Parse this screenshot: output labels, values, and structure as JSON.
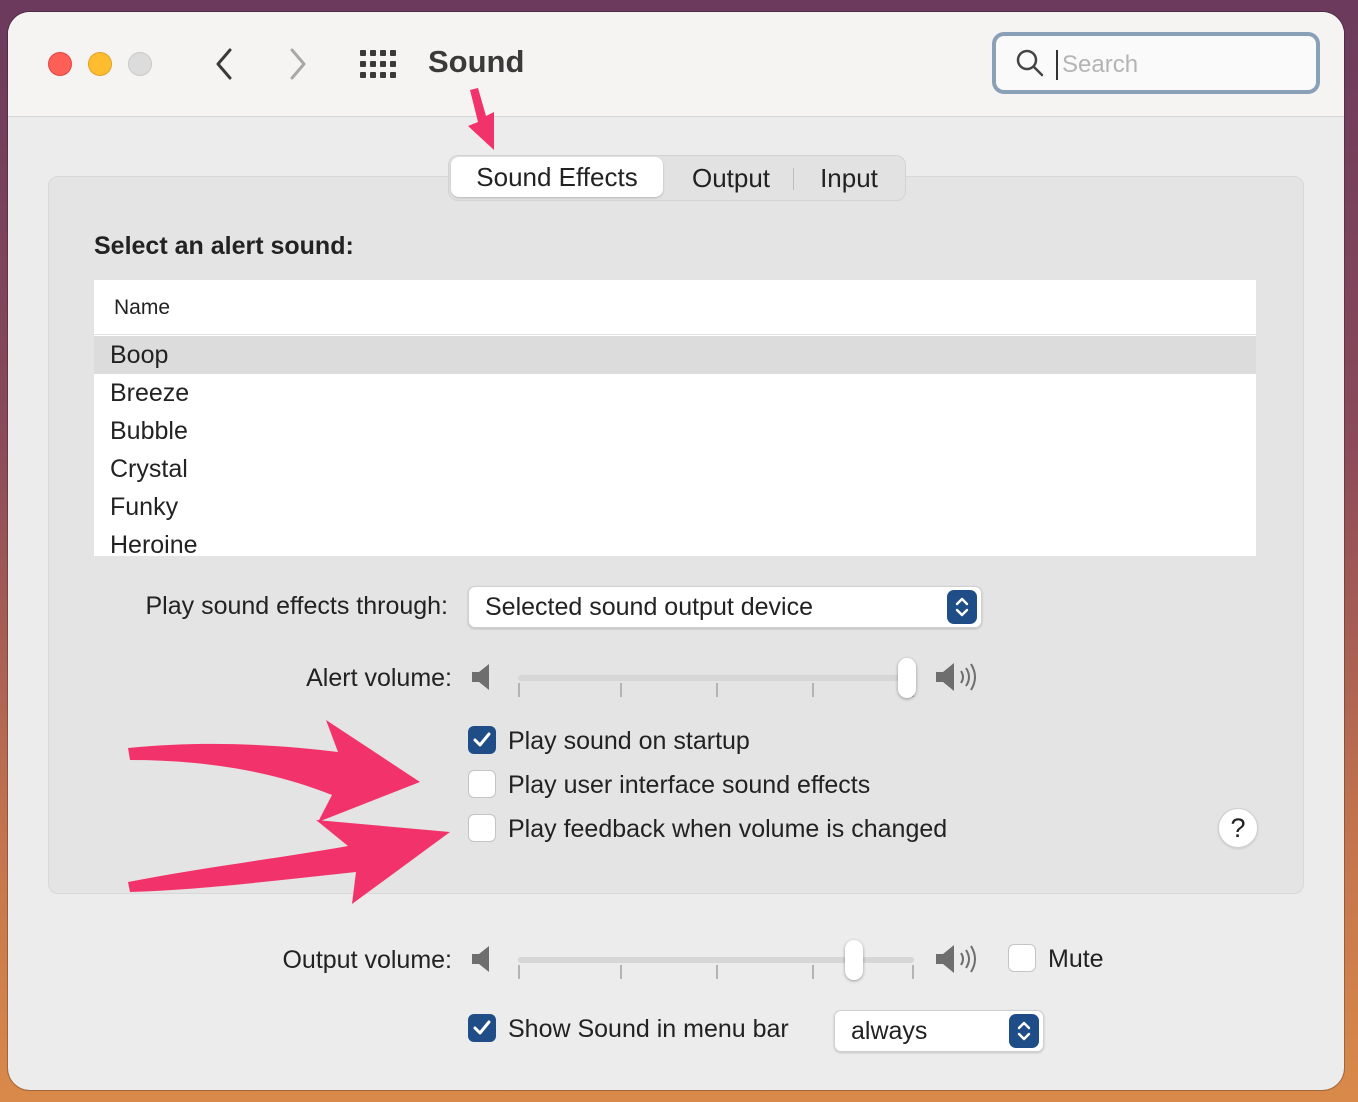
{
  "window": {
    "title": "Sound",
    "search_placeholder": "Search"
  },
  "tabs": [
    {
      "label": "Sound Effects",
      "selected": true
    },
    {
      "label": "Output",
      "selected": false
    },
    {
      "label": "Input",
      "selected": false
    }
  ],
  "alert_section": {
    "heading": "Select an alert sound:",
    "column_header": "Name",
    "sounds": [
      "Boop",
      "Breeze",
      "Bubble",
      "Crystal",
      "Funky",
      "Heroine"
    ],
    "selected_sound": "Boop"
  },
  "play_through": {
    "label": "Play sound effects through:",
    "value": "Selected sound output device"
  },
  "alert_volume": {
    "label": "Alert volume:",
    "level_fraction": 1.0
  },
  "options": [
    {
      "label": "Play sound on startup",
      "checked": true
    },
    {
      "label": "Play user interface sound effects",
      "checked": false
    },
    {
      "label": "Play feedback when volume is changed",
      "checked": false
    }
  ],
  "help_label": "?",
  "output_volume": {
    "label": "Output volume:",
    "level_fraction": 0.86,
    "mute_label": "Mute",
    "mute_checked": false
  },
  "menu_bar": {
    "label": "Show Sound in menu bar",
    "checked": true,
    "value": "always"
  },
  "colors": {
    "accent": "#1f4d87",
    "annotation_arrow": "#f2336b",
    "traffic_red": "#fe5f57",
    "traffic_yellow": "#febc2e"
  }
}
